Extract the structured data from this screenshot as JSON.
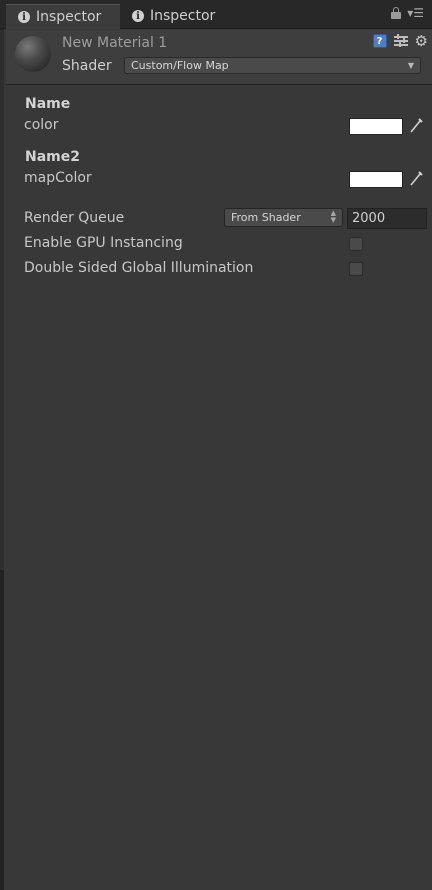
{
  "tabs": [
    {
      "label": "Inspector",
      "icon": "info-icon"
    },
    {
      "label": "Inspector",
      "icon": "info-icon"
    }
  ],
  "tabbar_icons": [
    "lock-icon",
    "menu-icon"
  ],
  "header": {
    "material_name": "New Material 1",
    "shader_label": "Shader",
    "shader_value": "Custom/Flow Map",
    "icons": [
      "help-icon",
      "preset-icon",
      "gear-icon"
    ]
  },
  "properties": [
    {
      "group": "Name",
      "label": "color",
      "value_color": "#ffffff"
    },
    {
      "group": "Name2",
      "label": "mapColor",
      "value_color": "#ffffff"
    }
  ],
  "render_queue": {
    "label": "Render Queue",
    "dropdown_value": "From Shader",
    "value": "2000"
  },
  "options": [
    {
      "label": "Enable GPU Instancing",
      "checked": false
    },
    {
      "label": "Double Sided Global Illumination",
      "checked": false
    }
  ],
  "colors": {
    "background": "#383838",
    "tabbar": "#282828",
    "accent_help": "#4f7fbf"
  }
}
